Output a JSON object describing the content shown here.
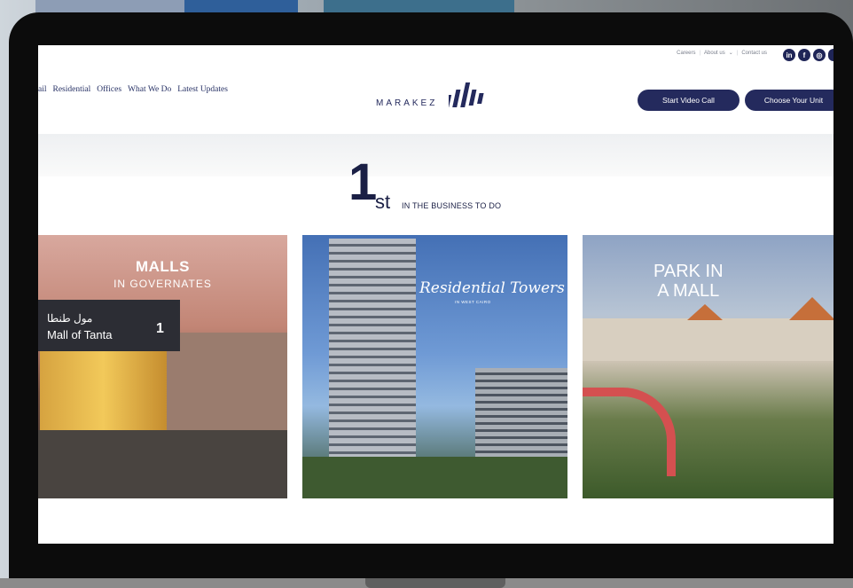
{
  "topbar": {
    "links": [
      "Careers",
      "About us",
      "Contact us"
    ],
    "social_icons": [
      "linkedin-icon",
      "facebook-icon",
      "instagram-icon"
    ]
  },
  "nav": {
    "items": [
      "ail",
      "Residential",
      "Offices",
      "What We Do",
      "Latest Updates"
    ]
  },
  "brand": {
    "name": "MARAKEZ",
    "color": "#242a5d"
  },
  "actions": {
    "video_call": "Start Video Call",
    "choose_unit": "Choose Your Unit"
  },
  "headline": {
    "number": "1",
    "suffix": "st",
    "text": "IN THE BUSINESS TO DO"
  },
  "cards": [
    {
      "title": "MALLS",
      "subtitle": "IN GOVERNATES",
      "sign_arabic": "مول طنطا",
      "sign_name": "Mall of Tanta",
      "sign_number": "1"
    },
    {
      "script_title": "Residential Towers",
      "script_sub": "IN WEST CAIRO"
    },
    {
      "title_line1": "PARK IN",
      "title_line2": "A MALL"
    }
  ]
}
